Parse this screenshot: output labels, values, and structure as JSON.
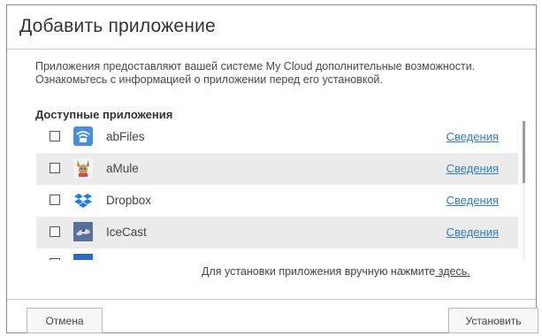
{
  "dialog": {
    "title": "Добавить приложение",
    "description": "Приложения предоставляют вашей системе My Cloud дополнительные возможности. Ознакомьтесь с информацией о приложении перед его установкой.",
    "section_heading": "Доступные приложения"
  },
  "apps": [
    {
      "name": "abFiles",
      "details_label": "Сведения",
      "checked": false,
      "icon": "abfiles-icon",
      "icon_color": "#4a90d9"
    },
    {
      "name": "aMule",
      "details_label": "Сведения",
      "checked": false,
      "icon": "amule-icon",
      "icon_color": "#b5845a"
    },
    {
      "name": "Dropbox",
      "details_label": "Сведения",
      "checked": false,
      "icon": "dropbox-icon",
      "icon_color": "#1f7fe0"
    },
    {
      "name": "IceCast",
      "details_label": "Сведения",
      "checked": false,
      "icon": "icecast-icon",
      "icon_color": "#5a6f9a"
    },
    {
      "name": "",
      "details_label": "",
      "checked": false,
      "icon": "partial-app-icon",
      "icon_color": "#2a6cc0"
    }
  ],
  "manual_install": {
    "text": "Для установки приложения вручную нажмите",
    "link_label": " здесь."
  },
  "buttons": {
    "cancel": "Отмена",
    "install": "Установить"
  },
  "colors": {
    "link": "#2f7ec6",
    "row_shade": "#ebebeb"
  }
}
